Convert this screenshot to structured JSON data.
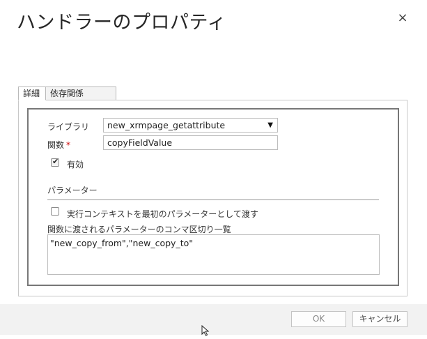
{
  "dialog": {
    "title": "ハンドラーのプロパティ",
    "close_glyph": "×"
  },
  "tabs": [
    {
      "label": "詳細",
      "active": true
    },
    {
      "label": "依存関係",
      "active": false
    }
  ],
  "form": {
    "library_label": "ライブラリ",
    "library_value": "new_xrmpage_getattribute",
    "library_arrow": "▼",
    "function_label": "関数",
    "required_mark": "*",
    "function_value": "copyFieldValue",
    "enabled_label": "有効",
    "enabled_checked": true,
    "params_header": "パラメーター",
    "pass_context_label": "実行コンテキストを最初のパラメーターとして渡す",
    "pass_context_checked": false,
    "params_list_label": "関数に渡されるパラメーターのコンマ区切り一覧",
    "params_list_value": "\"new_copy_from\",\"new_copy_to\""
  },
  "footer": {
    "ok_label": "OK",
    "cancel_label": "キャンセル"
  },
  "colors": {
    "required": "#cc0000",
    "footer_bg": "#f2f2f2"
  },
  "icons": {
    "close": "close-icon",
    "checkmark": "checkmark-icon",
    "dropdown": "chevron-down-icon",
    "cursor": "mouse-pointer-icon"
  }
}
